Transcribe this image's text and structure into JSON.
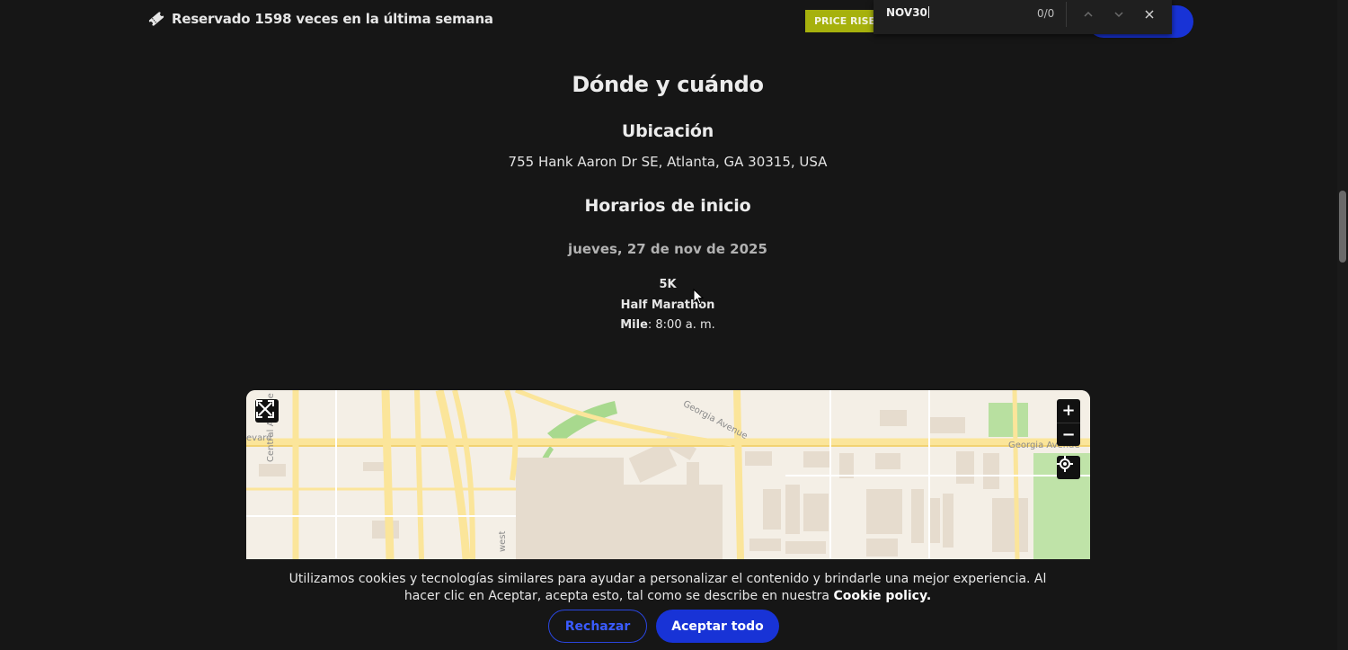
{
  "header": {
    "booked_text": "Reservado 1598 veces en la última semana",
    "price_badge": "PRICE RISES"
  },
  "find_bar": {
    "query": "NOV30",
    "count": "0/0"
  },
  "section": {
    "title": "Dónde y cuándo",
    "location_heading": "Ubicación",
    "address": "755 Hank Aaron Dr SE, Atlanta, GA 30315, USA",
    "start_times_heading": "Horarios de inicio",
    "date": "jueves, 27 de nov de 2025",
    "races": [
      {
        "name": "5K",
        "time": ""
      },
      {
        "name": "Half Marathon",
        "time": ""
      },
      {
        "name": "Mile",
        "time": "8:00 a. m."
      }
    ]
  },
  "map": {
    "labels": {
      "georgia_avenue_1": "Georgia Avenue",
      "georgia_avenue_2": "Georgia Avenue",
      "central_avenue": "Central Avenue Southwest",
      "boulevard_fragment": "evard",
      "west_fragment": "west"
    },
    "controls": {
      "zoom_in": "+",
      "zoom_out": "−"
    }
  },
  "cookie": {
    "text_prefix": "Utilizamos cookies y tecnologías similares para ayudar a personalizar el contenido y brindarle una mejor experiencia. Al hacer clic en Aceptar, acepta esto, tal como se describe en nuestra ",
    "policy_link": "Cookie policy",
    "text_suffix": ".",
    "reject_label": "Rechazar",
    "accept_label": "Aceptar todo"
  },
  "colors": {
    "background": "#161616",
    "accent_blue": "#1833d6",
    "badge_olive": "#a6b10d",
    "map_road_yellow": "#fbe59a"
  },
  "icons": [
    "ticket-icon",
    "chevron-up-icon",
    "chevron-down-icon",
    "close-icon",
    "fullscreen-icon",
    "locate-icon"
  ]
}
